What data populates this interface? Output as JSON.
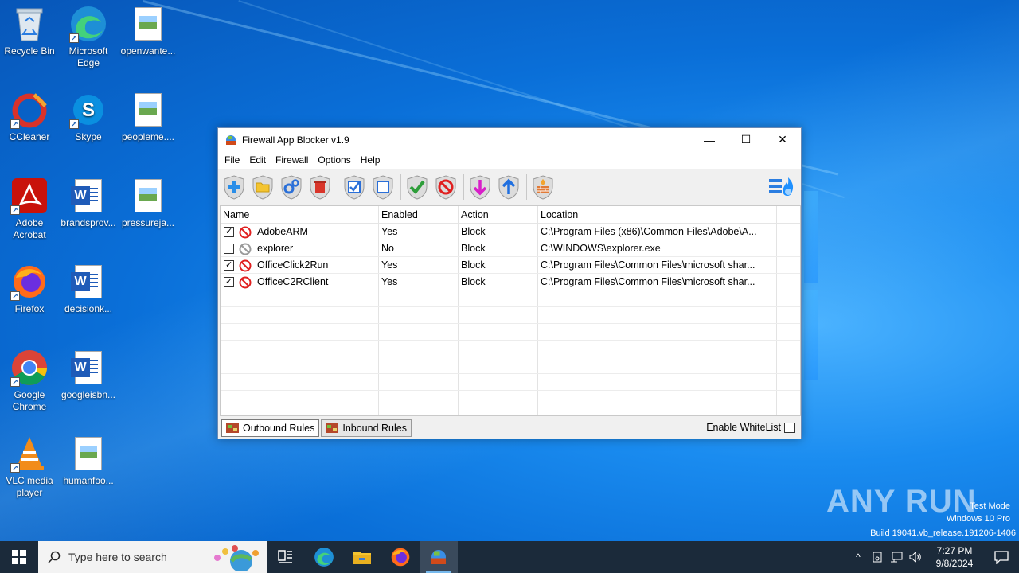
{
  "desktop": {
    "icons": [
      {
        "label": "Recycle Bin"
      },
      {
        "label": "Microsoft Edge"
      },
      {
        "label": "openwante..."
      },
      {
        "label": "CCleaner"
      },
      {
        "label": "Skype"
      },
      {
        "label": "peopleme...."
      },
      {
        "label": "Adobe Acrobat"
      },
      {
        "label": "brandsprov..."
      },
      {
        "label": "pressureja..."
      },
      {
        "label": "Firefox"
      },
      {
        "label": "decisionk..."
      },
      {
        "label": "Google Chrome"
      },
      {
        "label": "googleisbn..."
      },
      {
        "label": "VLC media player"
      },
      {
        "label": "humanfoo..."
      }
    ]
  },
  "window": {
    "title": "Firewall App Blocker v1.9",
    "controls": {
      "minimize": "—",
      "maximize": "☐",
      "close": "✕"
    }
  },
  "menu": {
    "items": [
      "File",
      "Edit",
      "Firewall",
      "Options",
      "Help"
    ]
  },
  "toolbar": {
    "buttons": [
      "add-icon",
      "folder-icon",
      "settings-icon",
      "delete-icon",
      "check-all-icon",
      "uncheck-all-icon",
      "allow-icon",
      "block-icon",
      "move-down-icon",
      "move-up-icon",
      "firewall-icon"
    ],
    "right_icon": "firewall-settings-icon"
  },
  "table": {
    "columns": [
      "Name",
      "Enabled",
      "Action",
      "Location"
    ],
    "rows": [
      {
        "checked": true,
        "name": "AdobeARM",
        "enabled": "Yes",
        "action": "Block",
        "location": "C:\\Program Files (x86)\\Common Files\\Adobe\\A...",
        "status_color": "#e02020"
      },
      {
        "checked": false,
        "name": "explorer",
        "enabled": "No",
        "action": "Block",
        "location": "C:\\WINDOWS\\explorer.exe",
        "status_color": "#9a9a9a"
      },
      {
        "checked": true,
        "name": "OfficeClick2Run",
        "enabled": "Yes",
        "action": "Block",
        "location": "C:\\Program Files\\Common Files\\microsoft shar...",
        "status_color": "#e02020"
      },
      {
        "checked": true,
        "name": "OfficeC2RClient",
        "enabled": "Yes",
        "action": "Block",
        "location": "C:\\Program Files\\Common Files\\microsoft shar...",
        "status_color": "#e02020"
      }
    ]
  },
  "status": {
    "tabs": [
      "Outbound Rules",
      "Inbound Rules"
    ],
    "whitelist_label": "Enable WhiteList",
    "whitelist_checked": false
  },
  "watermark": {
    "brand": "ANY RUN",
    "line1": "Test Mode",
    "line2": "Windows 10 Pro",
    "line3": "Build 19041.vb_release.191206-1406"
  },
  "taskbar": {
    "search_placeholder": "Type here to search",
    "time": "7:27 PM",
    "date": "9/8/2024"
  },
  "colors": {
    "accent": "#0a6fd8",
    "taskbar": "#1b2a3a",
    "block_red": "#e02020"
  }
}
